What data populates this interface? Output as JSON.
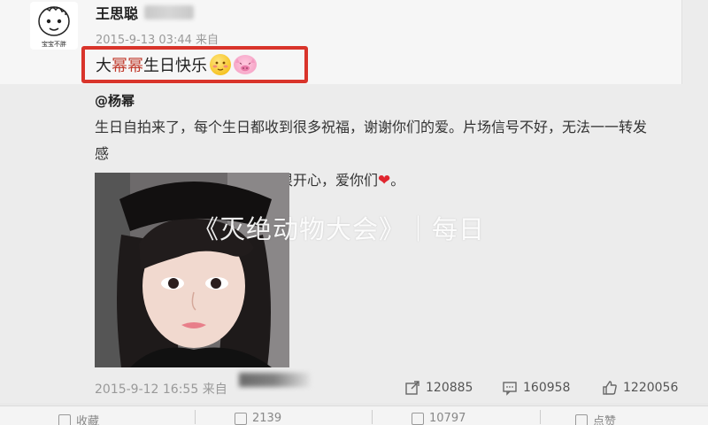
{
  "post": {
    "username": "王思聪",
    "time": "2015-9-13 03:44 来自",
    "text_prefix": "大",
    "text_highlight": "幂幂",
    "text_suffix": "生日快乐",
    "avatar_caption": "宝宝不胖",
    "emoji_1": "shy-face",
    "emoji_2": "pig-face",
    "highlight_color": "#d9342b"
  },
  "repost": {
    "author": "@杨幂",
    "text_line_1": "生日自拍来了，每个生日都收到很多祝福，谢谢你们的爱。片场信号不好，无法一一转发感",
    "text_line_2": "谢，但大家的心我都收到了，很开心，爱你们",
    "heart": "❤",
    "text_end": "。",
    "time": "2015-9-12 16:55 来自",
    "stats": {
      "forward": "120885",
      "comment": "160958",
      "like": "1220056"
    }
  },
  "watermark": "《灭绝动物大会》｜每日",
  "bottom_bar": {
    "item_1": "收藏",
    "item_2": "2139",
    "item_3": "10797",
    "item_4": "点赞"
  },
  "colors": {
    "heart": "#e0262f",
    "link": "#333333",
    "meta": "#9a9a9a"
  }
}
